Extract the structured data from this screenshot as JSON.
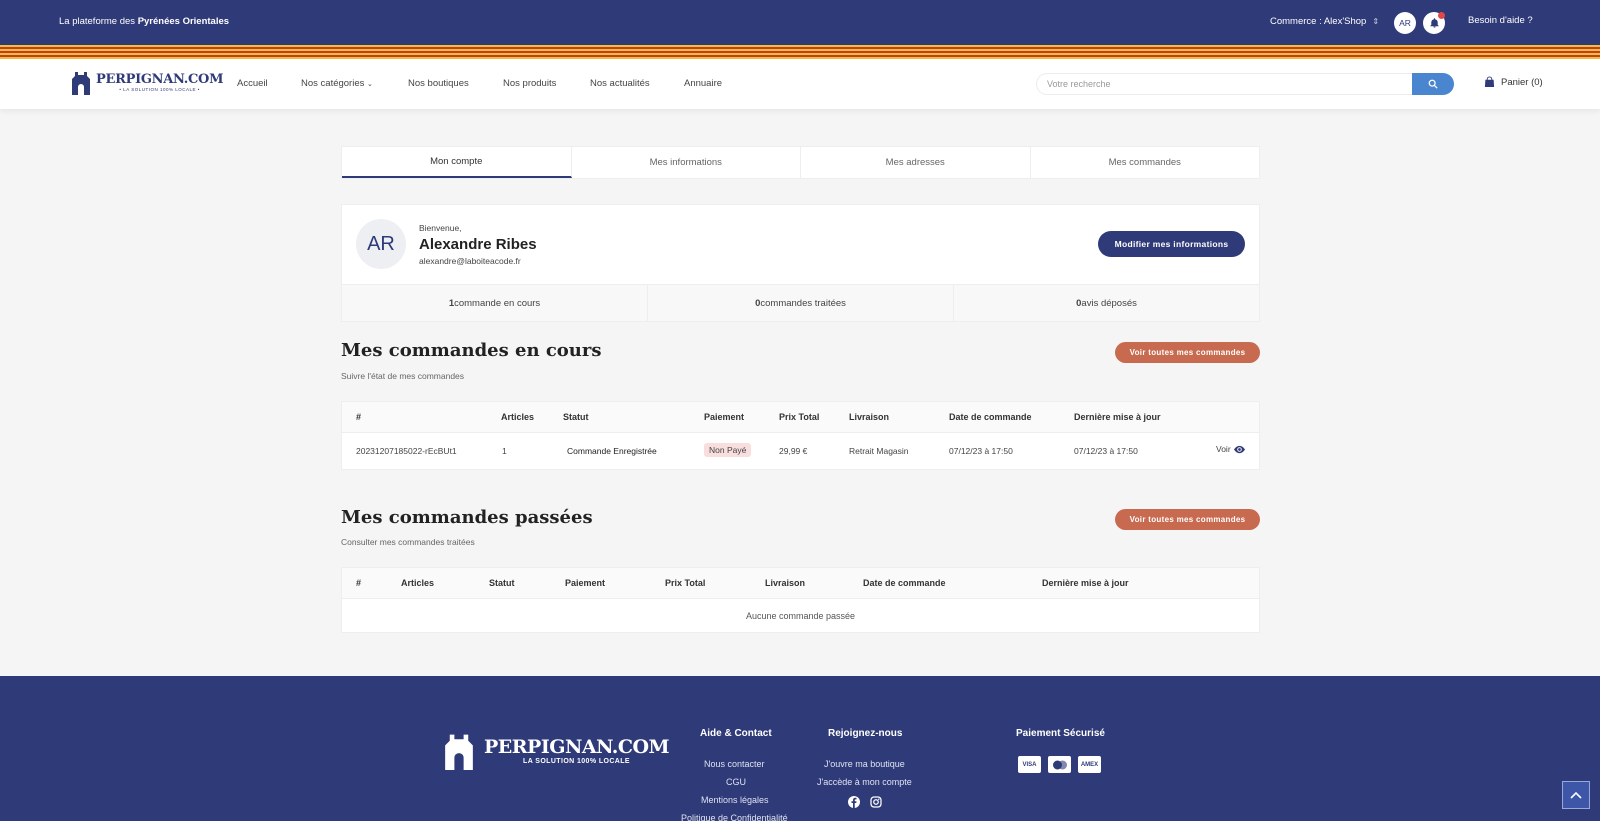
{
  "topbar": {
    "tagline_prefix": "La plateforme des ",
    "tagline_bold": "Pyrénées Orientales",
    "commerce": "Commerce : Alex'Shop",
    "avatar": "AR",
    "help": "Besoin d'aide ?"
  },
  "nav": {
    "logo_brand": "PERPIGNAN.COM",
    "logo_sub": "• LA SOLUTION 100% LOCALE •",
    "links": [
      "Accueil",
      "Nos catégories",
      "Nos boutiques",
      "Nos produits",
      "Nos actualités",
      "Annuaire"
    ],
    "search_placeholder": "Votre recherche",
    "cart": "Panier (0)"
  },
  "tabs": [
    "Mon compte",
    "Mes informations",
    "Mes adresses",
    "Mes commandes"
  ],
  "profile": {
    "avatar": "AR",
    "welcome": "Bienvenue,",
    "name": "Alexandre Ribes",
    "email": "alexandre@laboiteacode.fr",
    "edit_button": "Modifier mes informations",
    "stats": [
      {
        "bold": "1",
        "label": " commande en cours"
      },
      {
        "bold": "0",
        "label": " commandes traitées"
      },
      {
        "bold": "0",
        "label": " avis déposés"
      }
    ]
  },
  "current_orders": {
    "title": "Mes commandes en cours",
    "subtitle": "Suivre l'état de mes commandes",
    "button": "Voir toutes mes commandes",
    "headers": [
      "#",
      "Articles",
      "Statut",
      "Paiement",
      "Prix Total",
      "Livraison",
      "Date de commande",
      "Dernière mise à jour"
    ],
    "rows": [
      {
        "id": "20231207185022-rEcBUt1",
        "articles": "1",
        "status": "Commande Enregistrée",
        "payment": "Non Payé",
        "total": "29,99 €",
        "delivery": "Retrait Magasin",
        "date": "07/12/23 à 17:50",
        "updated": "07/12/23 à 17:50",
        "action": "Voir"
      }
    ]
  },
  "past_orders": {
    "title": "Mes commandes passées",
    "subtitle": "Consulter mes commandes traitées",
    "button": "Voir toutes mes commandes",
    "headers": [
      "#",
      "Articles",
      "Statut",
      "Paiement",
      "Prix Total",
      "Livraison",
      "Date de commande",
      "Dernière mise à jour"
    ],
    "empty": "Aucune commande passée"
  },
  "footer": {
    "logo_brand": "PERPIGNAN.COM",
    "logo_sub": "LA SOLUTION 100% LOCALE",
    "col1_title": "Aide & Contact",
    "col1_links": [
      "Nous contacter",
      "CGU",
      "Mentions légales",
      "Politique de Confidentialité"
    ],
    "col2_title": "Rejoignez-nous",
    "col2_links": [
      "J'ouvre ma boutique",
      "J'accède à mon compte"
    ],
    "col3_title": "Paiement Sécurisé",
    "cards": [
      "VISA",
      "MC",
      "AMEX"
    ]
  },
  "colors": {
    "primary": "#2f3a78",
    "accent": "#c86a4f",
    "search_btn": "#4a86cf"
  }
}
